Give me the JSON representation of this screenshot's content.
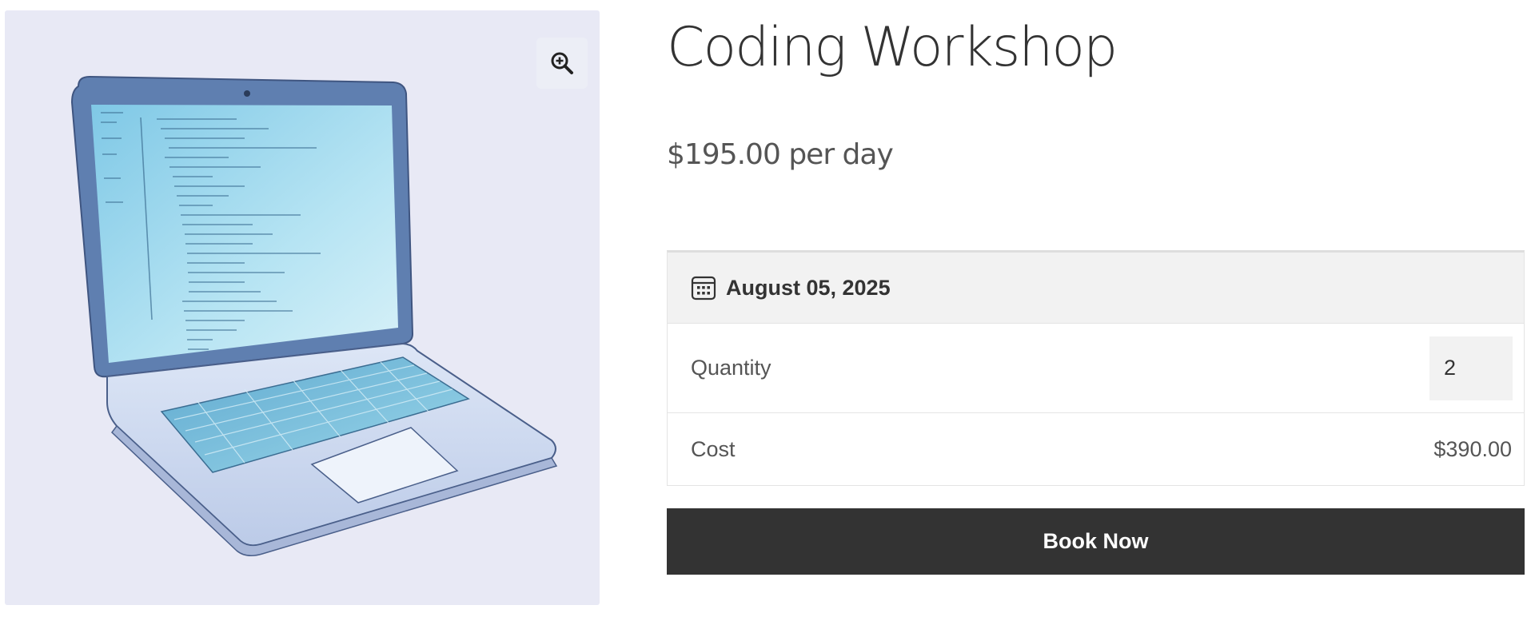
{
  "product": {
    "title": "Coding Workshop",
    "price": "$195.00 per day",
    "image_alt": "Laptop illustration"
  },
  "gallery": {
    "zoom_icon": "zoom-in-icon"
  },
  "booking": {
    "date_icon": "calendar-icon",
    "date": "August 05, 2025",
    "quantity_label": "Quantity",
    "quantity_value": "2",
    "cost_label": "Cost",
    "cost_value": "$390.00",
    "submit_label": "Book Now"
  },
  "colors": {
    "button_bg": "#333333",
    "image_bg": "#e8e9f5",
    "date_row_bg": "#f2f2f2"
  }
}
